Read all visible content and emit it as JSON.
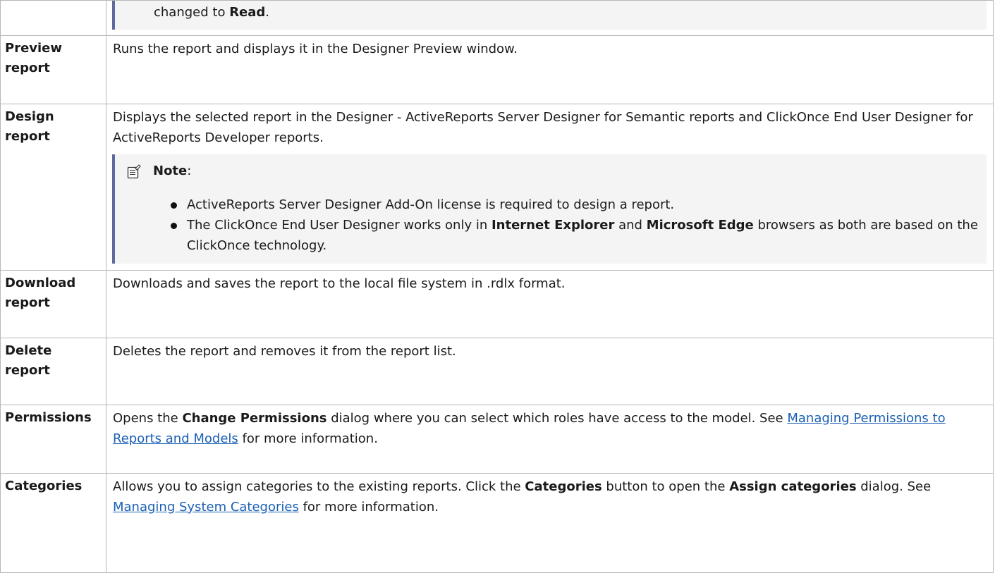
{
  "rows": [
    {
      "term": "",
      "callout_parts": [
        "changed to ",
        "Read",
        "."
      ]
    },
    {
      "term": "Preview report",
      "description": "Runs the report and displays it in the Designer Preview window."
    },
    {
      "term": "Design report",
      "description": "Displays the selected report in the Designer - ActiveReports Server Designer for Semantic reports and ClickOnce End User Designer for ActiveReports Developer reports.",
      "note": {
        "icon": "note-icon",
        "title": "Note",
        "title_suffix": ":",
        "items": [
          {
            "parts": [
              "ActiveReports Server Designer Add-On license is required to design a report."
            ]
          },
          {
            "parts": [
              "The ClickOnce End User Designer works only in ",
              "Internet Explorer",
              " and ",
              "Microsoft Edge",
              " browsers as both are based on the ClickOnce technology."
            ]
          }
        ]
      }
    },
    {
      "term": "Download report",
      "description": "Downloads and saves the report to the local file system in .rdlx format."
    },
    {
      "term": "Delete report",
      "description": "Deletes the report and removes it from the report list."
    },
    {
      "term": "Permissions",
      "parts": [
        "Opens the ",
        "Change Permissions",
        " dialog where you can select which roles have access to the model. See ",
        "Managing Permissions to Reports and Models",
        " for more information."
      ]
    },
    {
      "term": "Categories",
      "parts": [
        "Allows you to assign categories to the existing reports. Click the ",
        "Categories",
        " button to open the ",
        "Assign categories",
        " dialog. See ",
        "Managing System Categories",
        " for more information."
      ]
    }
  ],
  "colors": {
    "link": "#1a5fb4",
    "callout_bar": "#5c6b9c",
    "callout_bg": "#f4f4f4",
    "border": "#b7b7b7"
  }
}
